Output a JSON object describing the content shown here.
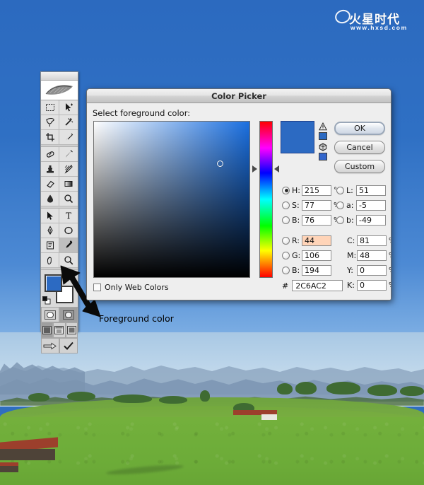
{
  "watermark": {
    "brand_cn": "火星时代",
    "url": "www.hxsd.com",
    "ellipse_icon": "ellipse-icon"
  },
  "dialog": {
    "title": "Color Picker",
    "prompt": "Select foreground color:",
    "buttons": {
      "ok": "OK",
      "cancel": "Cancel",
      "custom": "Custom"
    },
    "only_web_colors": {
      "label": "Only Web Colors",
      "checked": false
    },
    "hex": {
      "symbol": "#",
      "value": "2C6AC2"
    },
    "preview_color": "#2C6AC2",
    "hsb": [
      {
        "radio": "H",
        "selected": true,
        "label": "H:",
        "value": "215",
        "unit": "°"
      },
      {
        "radio": "S",
        "selected": false,
        "label": "S:",
        "value": "77",
        "unit": "%"
      },
      {
        "radio": "B",
        "selected": false,
        "label": "B:",
        "value": "76",
        "unit": "%"
      }
    ],
    "lab": [
      {
        "radio": "L",
        "selected": false,
        "label": "L:",
        "value": "51",
        "unit": ""
      },
      {
        "radio": "a",
        "selected": false,
        "label": "a:",
        "value": "-5",
        "unit": ""
      },
      {
        "radio": "b",
        "selected": false,
        "label": "b:",
        "value": "-49",
        "unit": ""
      }
    ],
    "rgb": [
      {
        "radio": "R",
        "selected": false,
        "label": "R:",
        "value": "44",
        "unit": "",
        "highlighted": true
      },
      {
        "radio": "G",
        "selected": false,
        "label": "G:",
        "value": "106",
        "unit": "",
        "highlighted": false
      },
      {
        "radio": "B",
        "selected": false,
        "label": "B:",
        "value": "194",
        "unit": "",
        "highlighted": false
      }
    ],
    "cmyk": [
      {
        "label": "C:",
        "value": "81",
        "unit": "%"
      },
      {
        "label": "M:",
        "value": "48",
        "unit": "%"
      },
      {
        "label": "Y:",
        "value": "0",
        "unit": "%"
      },
      {
        "label": "K:",
        "value": "0",
        "unit": "%"
      }
    ],
    "icons": {
      "gamut_warning": "gamut-warning-icon",
      "gamut_swatch": "gamut-alternate-swatch",
      "web_warning": "web-safe-warning-icon",
      "web_swatch": "web-safe-alternate-swatch"
    }
  },
  "annotation": {
    "label": "Foreground color",
    "arrow": "pointer-arrow"
  },
  "toolbox": {
    "logo": "feather-logo",
    "foreground_color": "#2C6AC2",
    "background_color": "#FFFFFF",
    "tools": [
      {
        "name": "marquee-tool",
        "glyph": "rect-dashed"
      },
      {
        "name": "move-tool",
        "glyph": "arrow-move"
      },
      {
        "name": "lasso-tool",
        "glyph": "lasso"
      },
      {
        "name": "magic-wand-tool",
        "glyph": "wand"
      },
      {
        "name": "crop-tool",
        "glyph": "crop"
      },
      {
        "name": "slice-tool",
        "glyph": "knife"
      },
      {
        "name": "healing-brush-tool",
        "glyph": "bandaid"
      },
      {
        "name": "brush-tool",
        "glyph": "brush"
      },
      {
        "name": "clone-stamp-tool",
        "glyph": "stamp"
      },
      {
        "name": "history-brush-tool",
        "glyph": "history-brush"
      },
      {
        "name": "eraser-tool",
        "glyph": "eraser"
      },
      {
        "name": "gradient-tool",
        "glyph": "gradient"
      },
      {
        "name": "blur-tool",
        "glyph": "droplet"
      },
      {
        "name": "dodge-tool",
        "glyph": "dodge"
      },
      {
        "name": "path-selection-tool",
        "glyph": "black-arrow"
      },
      {
        "name": "type-tool",
        "glyph": "letter-t"
      },
      {
        "name": "pen-tool",
        "glyph": "pen-nib"
      },
      {
        "name": "shape-tool",
        "glyph": "ellipse"
      },
      {
        "name": "notes-tool",
        "glyph": "note"
      },
      {
        "name": "eyedropper-tool",
        "glyph": "eyedropper"
      },
      {
        "name": "hand-tool",
        "glyph": "hand"
      },
      {
        "name": "zoom-tool",
        "glyph": "magnifier"
      }
    ],
    "mask_modes": [
      {
        "name": "standard-mode",
        "active": false
      },
      {
        "name": "quick-mask-mode",
        "active": true
      }
    ],
    "screen_modes": [
      {
        "name": "standard-screen-mode",
        "active": true
      },
      {
        "name": "full-screen-menubar-mode",
        "active": false
      },
      {
        "name": "full-screen-mode",
        "active": false
      }
    ],
    "bottom_tools": [
      {
        "name": "jump-to-imageready",
        "glyph": "jump-arrows"
      },
      {
        "name": "checkmark-button",
        "glyph": "checkmark"
      }
    ]
  },
  "photo": {
    "description": "alpine-meadow-landscape",
    "sky_color": "#BCD5EA",
    "meadow_color": "#6FAE3A",
    "mountain_color": "#8FA8C2",
    "barn_roof_color": "#9C3F2C"
  },
  "desktop": {
    "background_color": "#2C6AC2"
  }
}
